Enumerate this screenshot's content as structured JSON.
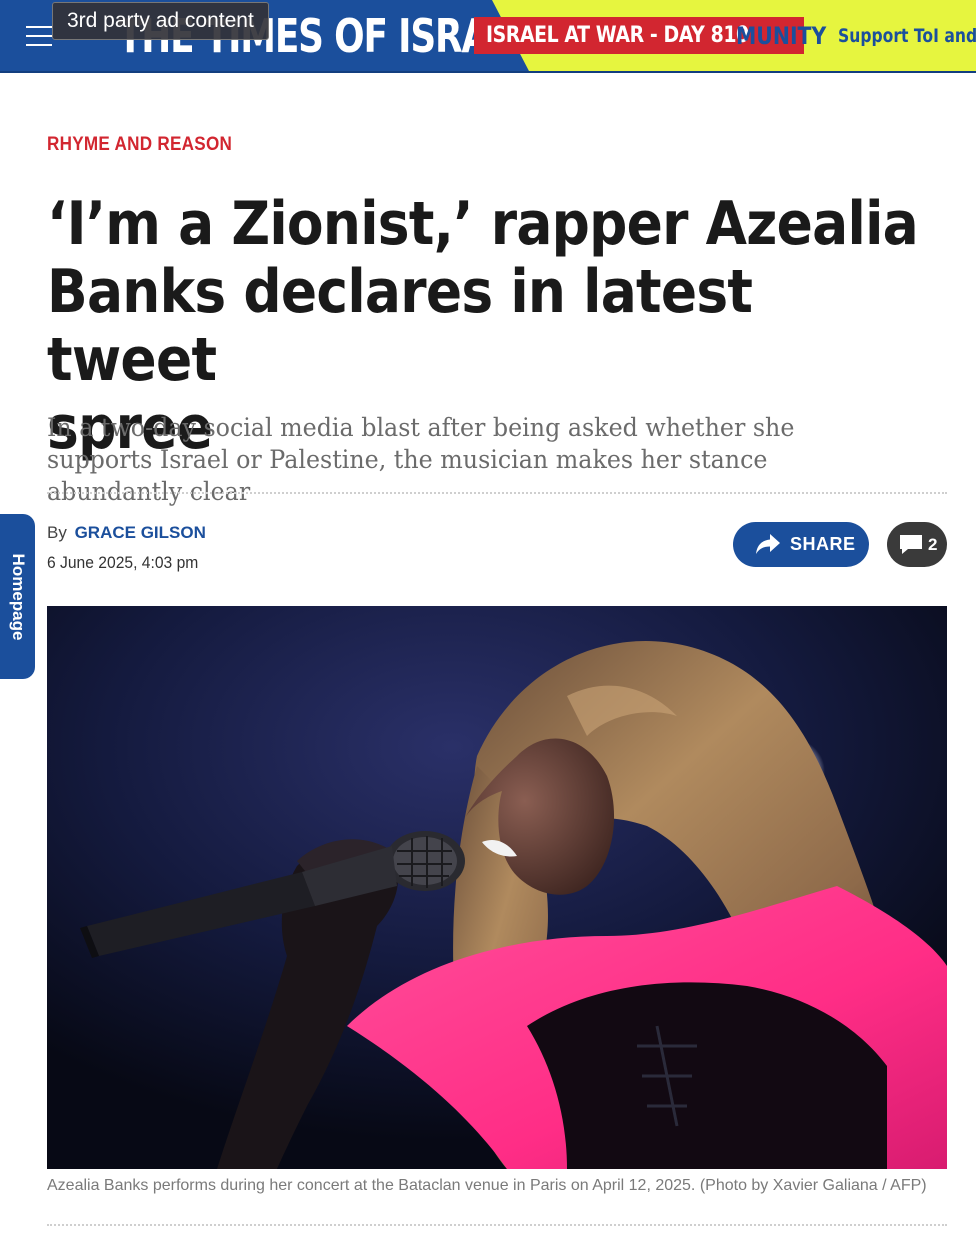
{
  "header": {
    "brand": "THE TIMES OF ISRAEL",
    "war_badge": "ISRAEL AT WAR - DAY 810",
    "community_label": "MUNITY",
    "support_label": "Support ToI and",
    "ad_label": "3rd party ad content",
    "colors": {
      "brand_blue": "#1b4f9c",
      "accent_red": "#d22630",
      "yellow": "#e6f53f"
    },
    "icons": {
      "menu": "hamburger-menu-icon"
    }
  },
  "side_tab": {
    "label": "Homepage"
  },
  "article": {
    "kicker": "RHYME AND REASON",
    "headline_lines": [
      "‘I’m a Zionist,’ rapper Azealia",
      "Banks declares in latest tweet",
      "spree"
    ],
    "subhead": "In a two-day social media blast after being asked whether she supports Israel or Palestine, the musician makes her stance abundantly clear",
    "byline_prefix": "By",
    "author": "GRACE GILSON",
    "date": "6 June 2025, 4:03 pm",
    "share_label": "SHARE",
    "comment_count": "2",
    "icons": {
      "share": "share-arrow-icon",
      "comments": "comment-bubble-icon"
    }
  },
  "photo": {
    "caption": "Azealia Banks performs during her concert at the Bataclan venue in Paris on April 12, 2025. (Photo by Xavier Galiana / AFP)"
  }
}
